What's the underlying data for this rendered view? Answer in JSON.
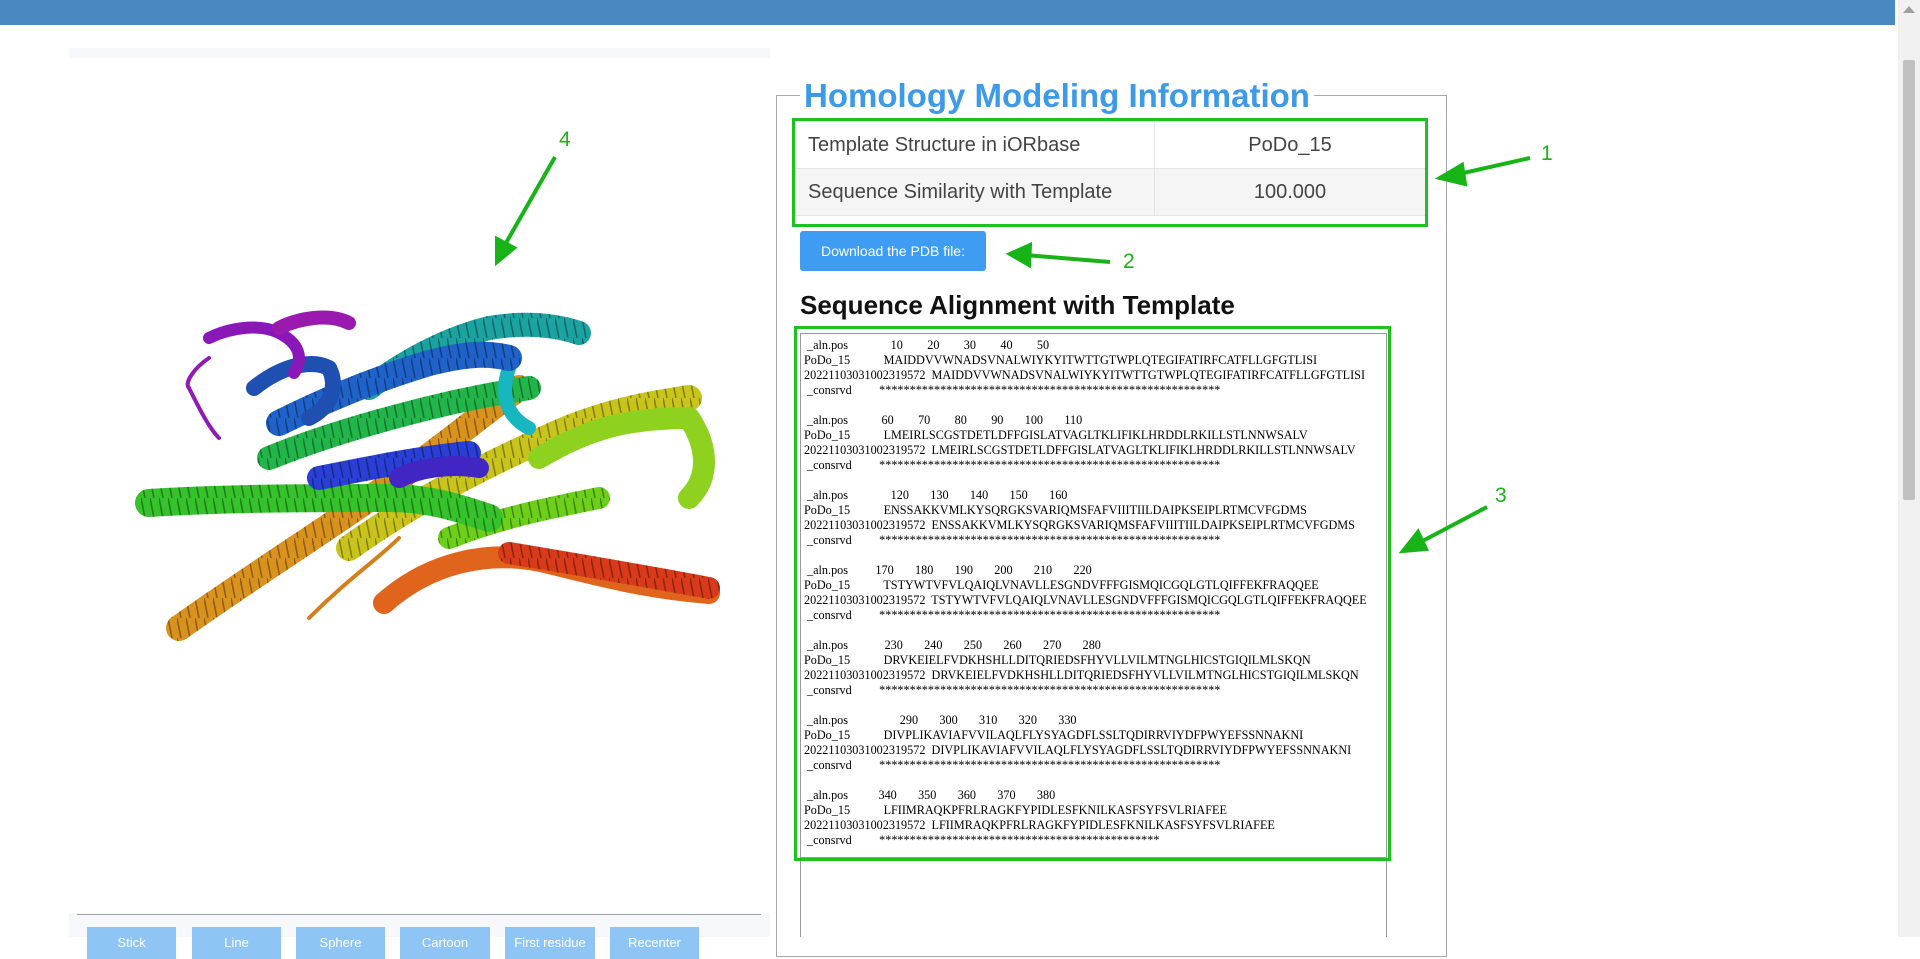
{
  "info": {
    "legend": "Homology Modeling Information",
    "rows": [
      {
        "label": "Template Structure in iORbase",
        "value": "PoDo_15"
      },
      {
        "label": "Sequence Similarity with Template",
        "value": "100.000"
      }
    ],
    "download_label": "Download the PDB file:"
  },
  "alignment": {
    "title": "Sequence Alignment with Template",
    "text": " _aln.pos              10        20        30        40        50\nPoDo_15           MAIDDVVWNADSVNALWIYKYITWTTGTWPLQTEGIFATIRFCATFLLGFGTLISI\n20221103031002319572  MAIDDVVWNADSVNALWIYKYITWTTGTWPLQTEGIFATIRFCATFLLGFGTLISI\n _consrvd         ********************************************************\n\n _aln.pos           60        70        80        90       100       110\nPoDo_15           LMEIRLSCGSTDETLDFFGISLATVAGLTKLIFIKLHRDDLRKILLSTLNNWSALV\n20221103031002319572  LMEIRLSCGSTDETLDFFGISLATVAGLTKLIFIKLHRDDLRKILLSTLNNWSALV\n _consrvd         ********************************************************\n\n _aln.pos              120       130       140       150       160\nPoDo_15           ENSSAKKVMLKYSQRGKSVARIQMSFAFVIIITIILDAIPKSEIPLRTMCVFGDMS\n20221103031002319572  ENSSAKKVMLKYSQRGKSVARIQMSFAFVIIITIILDAIPKSEIPLRTMCVFGDMS\n _consrvd         ********************************************************\n\n _aln.pos         170       180       190       200       210       220\nPoDo_15           TSTYWTVFVLQAIQLVNAVLLESGNDVFFFGISMQICGQLGTLQIFFEKFRAQQEE\n20221103031002319572  TSTYWTVFVLQAIQLVNAVLLESGNDVFFFGISMQICGQLGTLQIFFEKFRAQQEE\n _consrvd         ********************************************************\n\n _aln.pos            230       240       250       260       270       280\nPoDo_15           DRVKEIELFVDKHSHLLDITQRIEDSFHYVLLVILMTNGLHICSTGIQILMLSKQN\n20221103031002319572  DRVKEIELFVDKHSHLLDITQRIEDSFHYVLLVILMTNGLHICSTGIQILMLSKQN\n _consrvd         ********************************************************\n\n _aln.pos                 290       300       310       320       330\nPoDo_15           DIVPLIKAVIAFVVILAQLFLYSYAGDFLSSLTQDIRRVIYDFPWYEFSSNNAKNI\n20221103031002319572  DIVPLIKAVIAFVVILAQLFLYSYAGDFLSSLTQDIRRVIYDFPWYEFSSNNAKNI\n _consrvd         ********************************************************\n\n _aln.pos          340       350       360       370       380\nPoDo_15           LFIIMRAQKPFRLRAGKFYPIDLESFKNILKASFSYFSVLRIAFEE\n20221103031002319572  LFIIMRAQKPFRLRAGKFYPIDLESFKNILKASFSYFSVLRIAFEE\n _consrvd         **********************************************"
  },
  "viewer": {
    "buttons": [
      "Stick",
      "Line",
      "Sphere",
      "Cartoon",
      "First residue",
      "Recenter"
    ]
  },
  "annotations": [
    "1",
    "2",
    "3",
    "4"
  ],
  "colors": {
    "topbar": "#4a88c2",
    "legend": "#3d9ae8",
    "download_button": "#3e9cf2",
    "viewer_button": "#8ec5f5",
    "annotation": "#17b317"
  }
}
